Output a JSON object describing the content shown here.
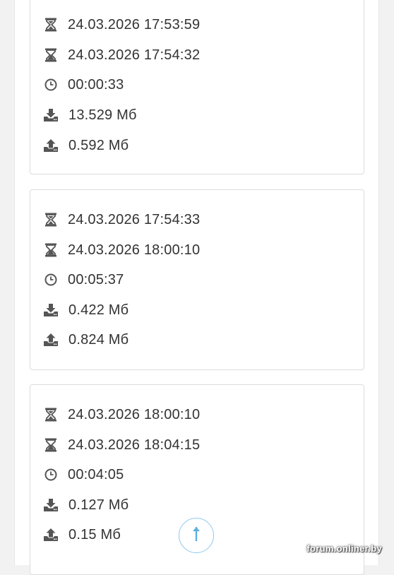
{
  "sessions": [
    {
      "start": "24.03.2026 17:53:59",
      "end": "24.03.2026 17:54:32",
      "duration": "00:00:33",
      "download": "13.529 Мб",
      "upload": "0.592 Мб"
    },
    {
      "start": "24.03.2026 17:54:33",
      "end": "24.03.2026 18:00:10",
      "duration": "00:05:37",
      "download": "0.422 Мб",
      "upload": "0.824 Мб"
    },
    {
      "start": "24.03.2026 18:00:10",
      "end": "24.03.2026 18:04:15",
      "duration": "00:04:05",
      "download": "0.127 Мб",
      "upload": "0.15 Мб"
    }
  ],
  "icons": {
    "start": "hourglass-start-icon",
    "end": "hourglass-end-icon",
    "duration": "clock-icon",
    "download": "download-icon",
    "upload": "upload-icon",
    "scroll_top": "arrow-up-icon"
  },
  "colors": {
    "icon": "#555555",
    "text": "#333333",
    "accent": "#5aafe0"
  },
  "watermark": "forum.onliner.by"
}
